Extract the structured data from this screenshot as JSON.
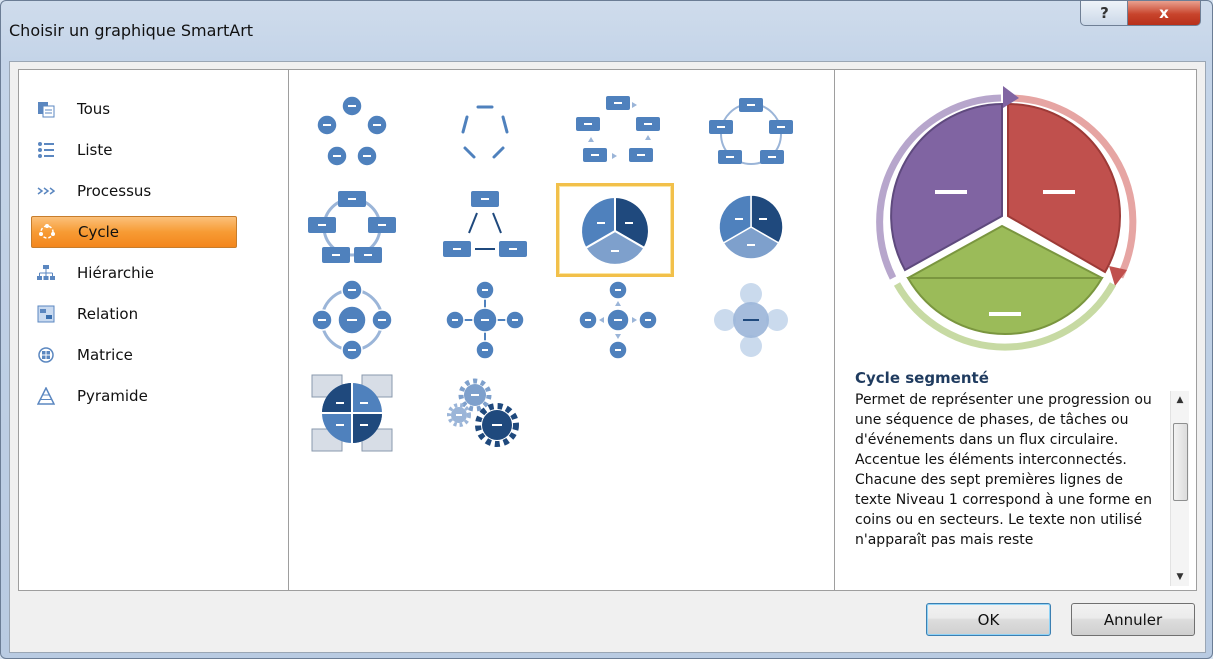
{
  "window": {
    "title": "Choisir un graphique SmartArt",
    "help_label": "?",
    "close_label": "x"
  },
  "categories": [
    {
      "label": "Tous",
      "icon": "all-grid-icon"
    },
    {
      "label": "Liste",
      "icon": "list-icon"
    },
    {
      "label": "Processus",
      "icon": "process-arrows-icon"
    },
    {
      "label": "Cycle",
      "icon": "cycle-icon",
      "selected": true
    },
    {
      "label": "Hiérarchie",
      "icon": "hierarchy-icon"
    },
    {
      "label": "Relation",
      "icon": "relation-icon"
    },
    {
      "label": "Matrice",
      "icon": "matrix-icon"
    },
    {
      "label": "Pyramide",
      "icon": "pyramid-icon"
    }
  ],
  "gallery": {
    "items": [
      {
        "name": "basic-cycle"
      },
      {
        "name": "text-cycle"
      },
      {
        "name": "block-cycle"
      },
      {
        "name": "nondirectional-cycle"
      },
      {
        "name": "continuous-cycle"
      },
      {
        "name": "multidirectional-cycle"
      },
      {
        "name": "segmented-cycle",
        "selected": true
      },
      {
        "name": "basic-pie"
      },
      {
        "name": "radial-cycle"
      },
      {
        "name": "basic-radial"
      },
      {
        "name": "diverging-radial"
      },
      {
        "name": "radial-venn"
      },
      {
        "name": "cycle-matrix"
      },
      {
        "name": "gear"
      }
    ]
  },
  "preview": {
    "title": "Cycle segmenté",
    "description": "Permet de représenter une progression ou une séquence de phases, de tâches ou d'événements dans un flux circulaire. Accentue les éléments interconnectés. Chacune des sept premières lignes de texte Niveau 1 correspond à une forme en coins ou en secteurs. Le texte non utilisé n'apparaît pas mais reste",
    "colors": {
      "purple": "#8064a2",
      "red": "#c0504d",
      "green": "#9bbb59"
    }
  },
  "buttons": {
    "ok": "OK",
    "cancel": "Annuler"
  },
  "colors": {
    "selection": "#f79b34",
    "accent": "#4f81bd",
    "dark_blue": "#1f497d"
  }
}
